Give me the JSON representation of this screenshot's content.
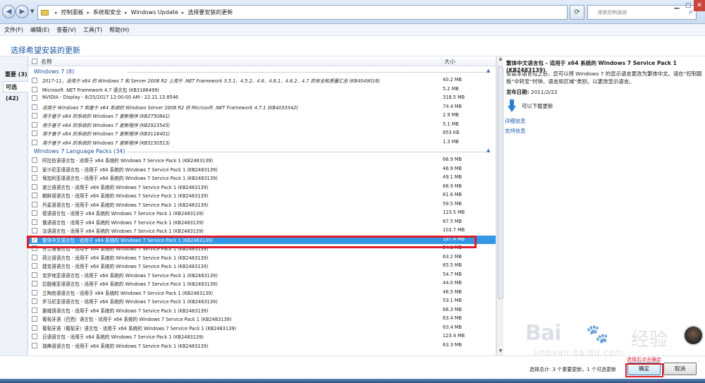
{
  "breadcrumb": {
    "items": [
      "控制面板",
      "系统和安全",
      "Windows Update",
      "选择要安装的更新"
    ]
  },
  "search": {
    "placeholder": "搜索控制面板"
  },
  "menubar": {
    "items": [
      "文件(F)",
      "编辑(E)",
      "查看(V)",
      "工具(T)",
      "帮助(H)"
    ]
  },
  "page": {
    "title": "选择希望安装的更新"
  },
  "tabs": [
    {
      "label": "重要 (3)"
    },
    {
      "label": "可选 (42)"
    }
  ],
  "list": {
    "header": {
      "name": "名称",
      "size": "大小"
    },
    "groups": [
      {
        "title": "Windows 7 (8)",
        "rows": [
          {
            "name": "2017-11，适用于 x64 的 Windows 7 和 Server 2008 R2 上用于 .NET Framework 3.5.1、4.5.2、4.6、4.6.1、4.6.2、4.7 的安全和质量汇总 (KB4049016)",
            "size": "40.2 MB",
            "italic": true,
            "checked": false
          },
          {
            "name": "Microsoft .NET Framework 4.7 语言包 (KB3186499)",
            "size": "5.2 MB",
            "italic": false,
            "checked": false
          },
          {
            "name": "NVIDIA - Display - 8/25/2017 12:00:00 AM - 22.21.13.8546",
            "size": "318.5 MB",
            "italic": false,
            "checked": false
          },
          {
            "name": "适用于 Windows 7 和基于 x64 系统的 Windows Server 2008 R2 的 Microsoft .NET Framework 4.7.1 (KB4033342)",
            "size": "74.4 MB",
            "italic": true,
            "checked": false
          },
          {
            "name": "用于基于 x64 的系统的 Windows 7 更新程序 (KB2750841)",
            "size": "2.9 MB",
            "italic": true,
            "checked": false
          },
          {
            "name": "用于基于 x64 的系统的 Windows 7 更新程序 (KB2923545)",
            "size": "5.1 MB",
            "italic": true,
            "checked": false
          },
          {
            "name": "用于基于 x64 的系统的 Windows 7 更新程序 (KB3118401)",
            "size": "853 KB",
            "italic": true,
            "checked": false
          },
          {
            "name": "用于基于 x64 的系统的 Windows 7 更新程序 (KB3150513)",
            "size": "1.3 MB",
            "italic": true,
            "checked": false
          }
        ]
      },
      {
        "title": "Windows 7 Language Packs (34)",
        "rows": [
          {
            "name": "阿拉伯语语言包 - 适用于 x64 系统的 Windows 7 Service Pack 1 (KB2483139)",
            "size": "66.9 MB",
            "italic": false,
            "checked": false
          },
          {
            "name": "爱沙尼亚语语言包 - 适用于 x64 系统的 Windows 7 Service Pack 1 (KB2483139)",
            "size": "46.9 MB",
            "italic": false,
            "checked": false
          },
          {
            "name": "保加利亚语语言包 - 适用于 x64 系统的 Windows 7 Service Pack 1 (KB2483139)",
            "size": "49.1 MB",
            "italic": false,
            "checked": false
          },
          {
            "name": "波兰语语言包 - 适用于 x64 系统的 Windows 7 Service Pack 1 (KB2483139)",
            "size": "66.9 MB",
            "italic": false,
            "checked": false
          },
          {
            "name": "朝鲜语语言包 - 适用于 x64 系统的 Windows 7 Service Pack 1 (KB2483139)",
            "size": "81.6 MB",
            "italic": false,
            "checked": false
          },
          {
            "name": "丹麦语语言包 - 适用于 x64 系统的 Windows 7 Service Pack 1 (KB2483139)",
            "size": "59.5 MB",
            "italic": false,
            "checked": false
          },
          {
            "name": "德语语言包 - 适用于 x64 系统的 Windows 7 Service Pack 1 (KB2483139)",
            "size": "123.5 MB",
            "italic": false,
            "checked": false
          },
          {
            "name": "俄语语言包 - 适用于 x64 系统的 Windows 7 Service Pack 1 (KB2483139)",
            "size": "67.5 MB",
            "italic": false,
            "checked": false
          },
          {
            "name": "法语语言包 - 适用于 x64 系统的 Windows 7 Service Pack 1 (KB2483139)",
            "size": "103.7 MB",
            "italic": false,
            "checked": false
          },
          {
            "name": "繁体中文语言包 - 适用于 x64 系统的 Windows 7 Service Pack 1 (KB2483139)",
            "size": "187.4 MB",
            "italic": false,
            "checked": true,
            "selected": true
          },
          {
            "name": "芬兰语语言包 - 适用于 x64 系统的 Windows 7 Service Pack 1 (KB2483139)",
            "size": "54.1 MB",
            "italic": false,
            "checked": false
          },
          {
            "name": "荷兰语语言包 - 适用于 x64 系统的 Windows 7 Service Pack 1 (KB2483139)",
            "size": "63.2 MB",
            "italic": false,
            "checked": false
          },
          {
            "name": "捷克语语言包 - 适用于 x64 系统的 Windows 7 Service Pack 1 (KB2483139)",
            "size": "65.5 MB",
            "italic": false,
            "checked": false
          },
          {
            "name": "克罗地亚语语言包 - 适用于 x64 系统的 Windows 7 Service Pack 1 (KB2483139)",
            "size": "54.7 MB",
            "italic": false,
            "checked": false
          },
          {
            "name": "拉脱维亚语语言包 - 适用于 x64 系统的 Windows 7 Service Pack 1 (KB2483139)",
            "size": "44.0 MB",
            "italic": false,
            "checked": false
          },
          {
            "name": "立陶宛语语言包 - 适用于 x64 系统的 Windows 7 Service Pack 1 (KB2483139)",
            "size": "48.5 MB",
            "italic": false,
            "checked": false
          },
          {
            "name": "罗马尼亚语语言包 - 适用于 x64 系统的 Windows 7 Service Pack 1 (KB2483139)",
            "size": "53.1 MB",
            "italic": false,
            "checked": false
          },
          {
            "name": "挪威语语言包 - 适用于 x64 系统的 Windows 7 Service Pack 1 (KB2483139)",
            "size": "66.3 MB",
            "italic": false,
            "checked": false
          },
          {
            "name": "葡萄牙语（巴西）语言包 - 适用于 x64 系统的 Windows 7 Service Pack 1 (KB2483139)",
            "size": "63.4 MB",
            "italic": false,
            "checked": false
          },
          {
            "name": "葡萄牙语（葡萄牙）语言包 - 适用于 x64 系统的 Windows 7 Service Pack 1 (KB2483139)",
            "size": "63.4 MB",
            "italic": false,
            "checked": false
          },
          {
            "name": "日语语言包 - 适用于 x64 系统的 Windows 7 Service Pack 1 (KB2483139)",
            "size": "123.4 MB",
            "italic": false,
            "checked": false
          },
          {
            "name": "瑞典语语言包 - 适用于 x64 系统的 Windows 7 Service Pack 1 (KB2483139)",
            "size": "63.3 MB",
            "italic": false,
            "checked": false
          }
        ]
      }
    ]
  },
  "details": {
    "title": "繁体中文语言包 - 适用于 x64 系统的 Windows 7 Service Pack 1 (KB2483139)",
    "description": "安装本语言包之后，您可以将 Windows 7 的显示语言更改为繁体中文。请在“控制面板”中转至“时钟、语言和区域”类别，以更改显示语言。",
    "publish_label": "发布日期:",
    "publish_date": "2011/2/22",
    "download_text": "可以下载更新",
    "details_link": "详细信息",
    "support_link": "支持信息"
  },
  "bottom": {
    "status": "选择总计: 3 个重要更新，1 个可选更新",
    "annotation": "选择后点击确定",
    "ok": "确定",
    "cancel": "取消"
  },
  "watermark": {
    "logo": "Bai",
    "cn": "经验",
    "url": "jingyan.baidu.com"
  },
  "colors": {
    "accent": "#1e5aa8",
    "selection": "#3298e5",
    "annotation": "#de1f2a"
  }
}
